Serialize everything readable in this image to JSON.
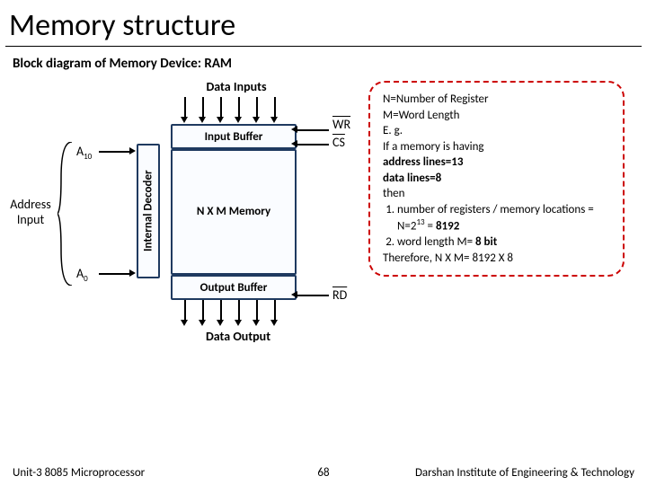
{
  "title": "Memory structure",
  "subtitle": "Block diagram of Memory Device: RAM",
  "labels": {
    "data_inputs": "Data Inputs",
    "input_buffer": "Input Buffer",
    "internal_decoder": "Internal Decoder",
    "nxm_memory": "N X M Memory",
    "output_buffer": "Output Buffer",
    "data_output": "Data Output",
    "address_input": "Address Input",
    "a10_base": "A",
    "a10_sub": "10",
    "a0_base": "A",
    "a0_sub": "0",
    "wr": "WR",
    "cs": "CS",
    "rd": "RD"
  },
  "note": {
    "l1a": "N=Number of Register",
    "l1b": "M=Word Length",
    "l2": "E. g.",
    "l3": "If a memory is having",
    "l4a": "address lines=13",
    "l4b": "data lines=8",
    "l5": "then",
    "li1a": "number of registers / memory locations = N=2",
    "li1_sup": "13",
    "li1b": " = ",
    "li1c": "8192",
    "li2a": "word length M= ",
    "li2b": "8 bit",
    "l6a": "Therefore, N X M= 8192 X 8"
  },
  "footer": {
    "left": "Unit-3 8085 Microprocessor",
    "page": "68",
    "right": "Darshan Institute of Engineering & Technology"
  }
}
